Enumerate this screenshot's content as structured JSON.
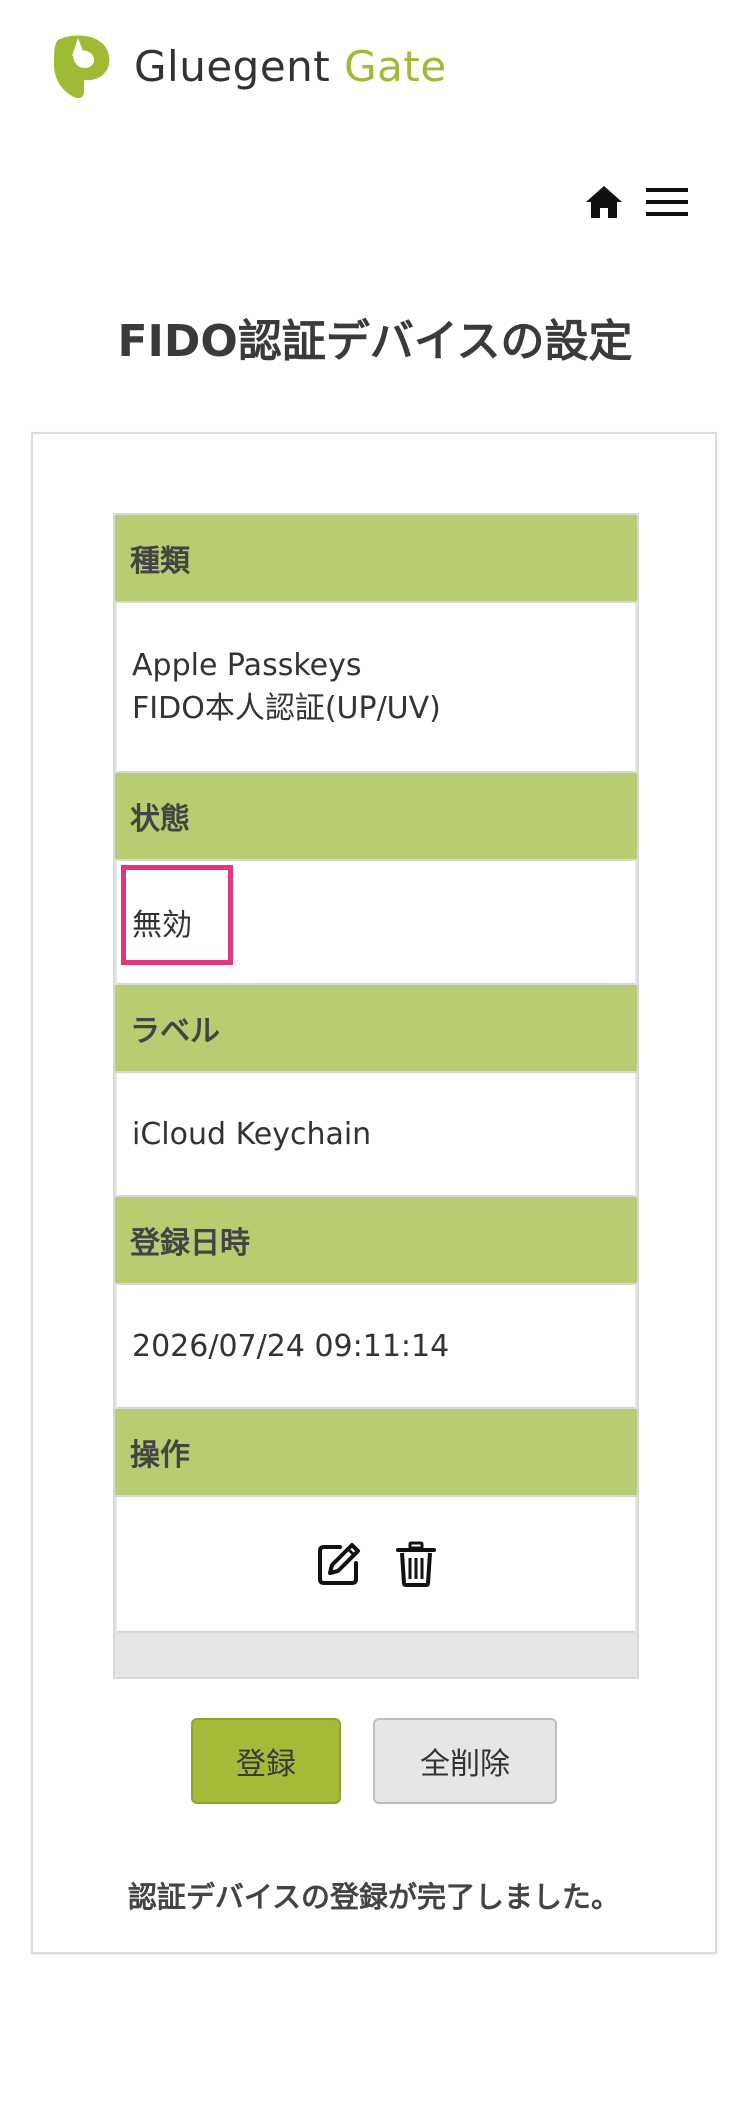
{
  "brand": {
    "name_part1": "Gluegent",
    "name_part2": "Gate",
    "accent": "#9fbb35"
  },
  "nav": {
    "home_icon": "home-icon",
    "menu_icon": "hamburger-menu-icon"
  },
  "page_title": "FIDO認証デバイスの設定",
  "device": {
    "type_header": "種類",
    "type_line1": "Apple Passkeys",
    "type_line2": "FIDO本人認証(UP/UV)",
    "status_header": "状態",
    "status_value": "無効",
    "label_header": "ラベル",
    "label_value": "iCloud Keychain",
    "registered_header": "登録日時",
    "registered_value": "2026/07/24 09:11:14",
    "actions_header": "操作",
    "edit_icon": "edit-icon",
    "delete_icon": "trash-icon"
  },
  "buttons": {
    "register": "登録",
    "delete_all": "全削除"
  },
  "message": "認証デバイスの登録が完了しました。",
  "colors": {
    "header_row": "#b8cd72",
    "register_button": "#a4ba38",
    "highlight": "#e0377f"
  }
}
